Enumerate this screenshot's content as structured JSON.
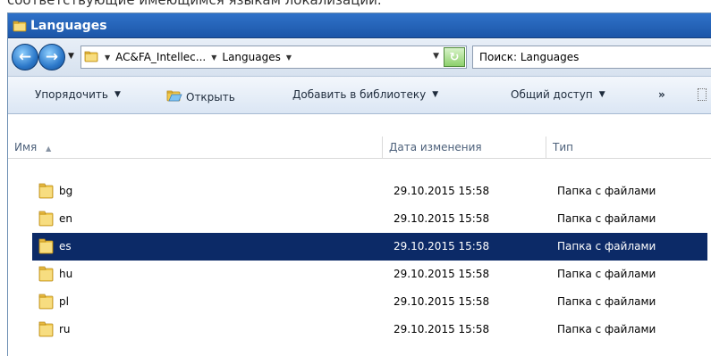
{
  "top_text": "соответствующие имеющимся языкам локализации.",
  "window": {
    "title": "Languages",
    "address": {
      "segments": [
        "AC&FA_Intellec...",
        "Languages"
      ]
    },
    "search": {
      "text": "Поиск: Languages"
    },
    "toolbar": {
      "organize": "Упорядочить",
      "open": "Открыть",
      "library": "Добавить в библиотеку",
      "share": "Общий доступ",
      "more": "»"
    },
    "columns": {
      "name": "Имя",
      "date": "Дата изменения",
      "type": "Тип"
    },
    "files": [
      {
        "name": "bg",
        "date": "29.10.2015 15:58",
        "type": "Папка с файлами",
        "selected": false
      },
      {
        "name": "en",
        "date": "29.10.2015 15:58",
        "type": "Папка с файлами",
        "selected": false
      },
      {
        "name": "es",
        "date": "29.10.2015 15:58",
        "type": "Папка с файлами",
        "selected": true
      },
      {
        "name": "hu",
        "date": "29.10.2015 15:58",
        "type": "Папка с файлами",
        "selected": false
      },
      {
        "name": "pl",
        "date": "29.10.2015 15:58",
        "type": "Папка с файлами",
        "selected": false
      },
      {
        "name": "ru",
        "date": "29.10.2015 15:58",
        "type": "Папка с файлами",
        "selected": false
      }
    ]
  },
  "colors": {
    "titlebar": "#2f72c9",
    "selection": "#0c2a67",
    "folder": "#f2c94c"
  },
  "icons": {
    "back": "back-arrow-icon",
    "forward": "forward-arrow-icon",
    "folder": "folder-icon",
    "refresh": "refresh-icon",
    "open": "open-folder-icon"
  }
}
